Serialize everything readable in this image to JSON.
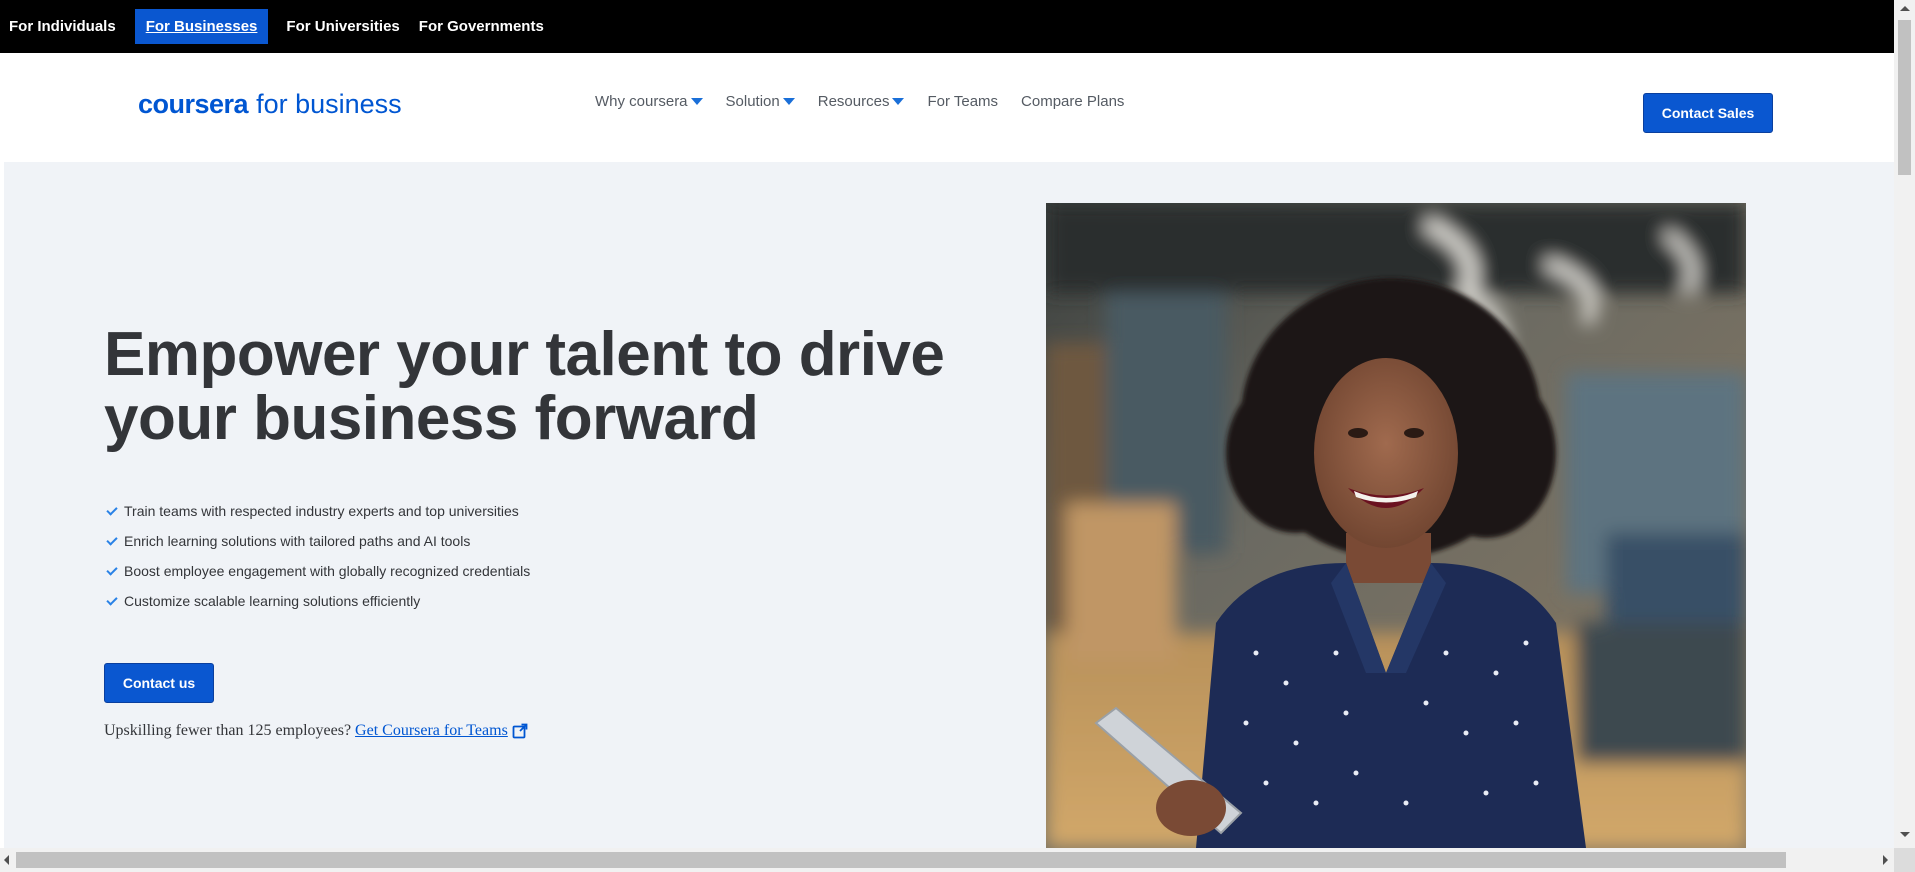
{
  "audience_bar": {
    "items": [
      {
        "label": "For Individuals",
        "active": false
      },
      {
        "label": "For Businesses",
        "active": true
      },
      {
        "label": "For Universities",
        "active": false
      },
      {
        "label": "For Governments",
        "active": false
      }
    ]
  },
  "header": {
    "logo_brand": "coursera",
    "logo_suffix": "for business",
    "nav": [
      {
        "label": "Why coursera",
        "has_dropdown": true
      },
      {
        "label": "Solution",
        "has_dropdown": true
      },
      {
        "label": "Resources",
        "has_dropdown": true
      },
      {
        "label": "For Teams",
        "has_dropdown": false
      },
      {
        "label": "Compare Plans",
        "has_dropdown": false
      }
    ],
    "contact_sales_label": "Contact Sales"
  },
  "hero": {
    "headline": "Empower your talent to drive your business forward",
    "bullets": [
      "Train teams with respected industry experts and top universities",
      "Enrich learning solutions with tailored paths and AI tools",
      "Boost employee engagement with globally recognized credentials",
      "Customize scalable learning solutions efficiently"
    ],
    "contact_us_label": "Contact us",
    "upskill_text": "Upskilling fewer than 125 employees?",
    "teams_link_label": "Get Coursera for Teams"
  },
  "colors": {
    "accent": "#0056d2",
    "button": "#0a57d0",
    "hero_bg": "#f0f3f7",
    "check": "#2a82e6"
  }
}
